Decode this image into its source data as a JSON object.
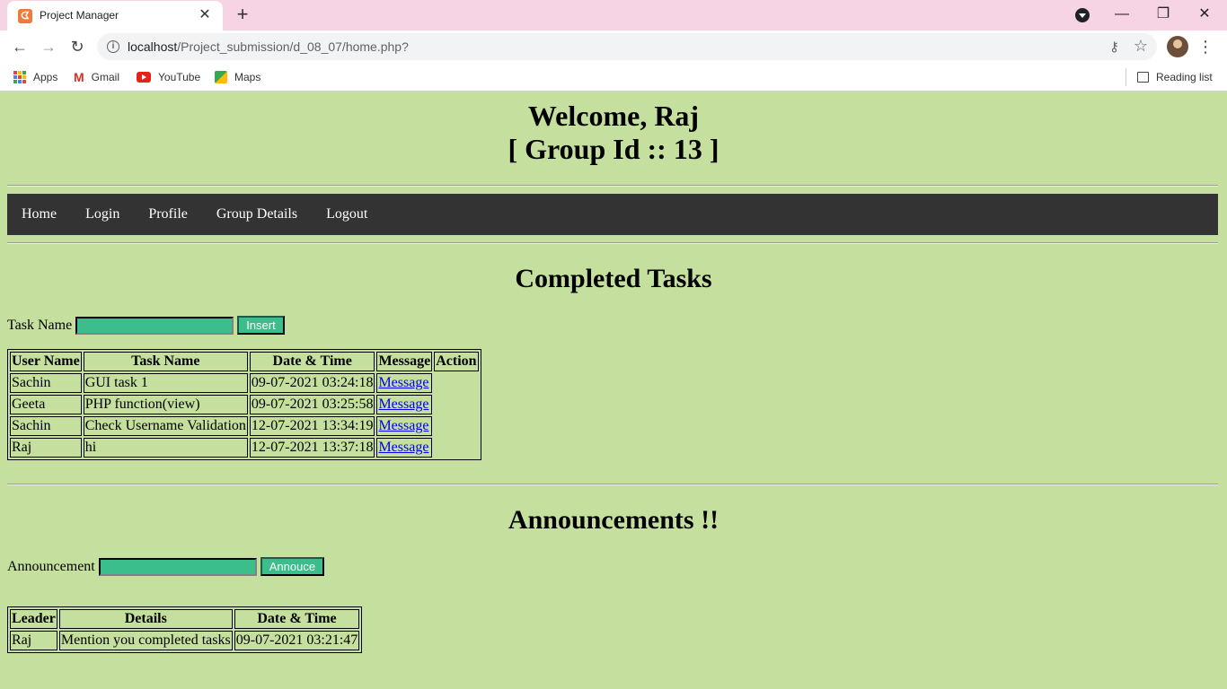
{
  "browser": {
    "tab_title": "Project Manager",
    "url_host": "localhost",
    "url_path": "/Project_submission/d_08_07/home.php?",
    "bookmarks": [
      "Apps",
      "Gmail",
      "YouTube",
      "Maps"
    ],
    "reading_list": "Reading list"
  },
  "header": {
    "welcome": "Welcome, Raj",
    "group": "[ Group Id :: 13 ]"
  },
  "nav": [
    "Home",
    "Login",
    "Profile",
    "Group Details",
    "Logout"
  ],
  "completed": {
    "title": "Completed Tasks",
    "input_label": "Task Name",
    "button": "Insert",
    "columns": [
      "User Name",
      "Task Name",
      "Date & Time",
      "Message",
      "Action"
    ],
    "rows": [
      [
        "Sachin",
        "GUI task 1",
        "09-07-2021 03:24:18",
        "Message"
      ],
      [
        "Geeta",
        "PHP function(view)",
        "09-07-2021 03:25:58",
        "Message"
      ],
      [
        "Sachin",
        "Check Username Validation",
        "12-07-2021 13:34:19",
        "Message"
      ],
      [
        "Raj",
        "hi",
        "12-07-2021 13:37:18",
        "Message"
      ]
    ]
  },
  "announcements": {
    "title": "Announcements !!",
    "input_label": "Announcement",
    "button": "Annouce",
    "columns": [
      "Leader",
      "Details",
      "Date & Time"
    ],
    "rows": [
      [
        "Raj",
        "Mention you completed tasks",
        "09-07-2021 03:21:47"
      ]
    ]
  }
}
